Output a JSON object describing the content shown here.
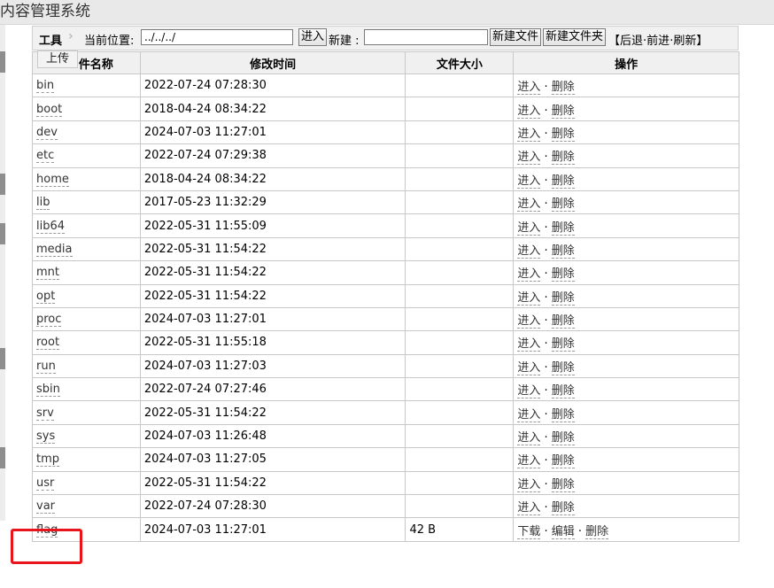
{
  "app": {
    "title": "内容管理系统"
  },
  "toolbar": {
    "tools_label": "工具",
    "arrow": "›",
    "current_location_label": "当前位置:",
    "path_value": "../../../",
    "enter_button": "进入",
    "new_label": "新建 :",
    "new_value": "",
    "new_file_button": "新建文件",
    "new_folder_button": "新建文件夹",
    "nav_open": "【",
    "back": "后退",
    "sep": "·",
    "forward": "前进",
    "refresh": "刷新",
    "nav_close": "】"
  },
  "upload_tab": {
    "label": "上传"
  },
  "table": {
    "headers": [
      "件名称",
      "修改时间",
      "文件大小",
      "操作"
    ],
    "rows": [
      {
        "name": "bin",
        "mtime": "2022-07-24 07:28:30",
        "size": "",
        "a1": "进入",
        "a2": "删除",
        "a3": ""
      },
      {
        "name": "boot",
        "mtime": "2018-04-24 08:34:22",
        "size": "",
        "a1": "进入",
        "a2": "删除",
        "a3": ""
      },
      {
        "name": "dev",
        "mtime": "2024-07-03 11:27:01",
        "size": "",
        "a1": "进入",
        "a2": "删除",
        "a3": ""
      },
      {
        "name": "etc",
        "mtime": "2022-07-24 07:29:38",
        "size": "",
        "a1": "进入",
        "a2": "删除",
        "a3": ""
      },
      {
        "name": "home",
        "mtime": "2018-04-24 08:34:22",
        "size": "",
        "a1": "进入",
        "a2": "删除",
        "a3": ""
      },
      {
        "name": "lib",
        "mtime": "2017-05-23 11:32:29",
        "size": "",
        "a1": "进入",
        "a2": "删除",
        "a3": ""
      },
      {
        "name": "lib64",
        "mtime": "2022-05-31 11:55:09",
        "size": "",
        "a1": "进入",
        "a2": "删除",
        "a3": ""
      },
      {
        "name": "media",
        "mtime": "2022-05-31 11:54:22",
        "size": "",
        "a1": "进入",
        "a2": "删除",
        "a3": ""
      },
      {
        "name": "mnt",
        "mtime": "2022-05-31 11:54:22",
        "size": "",
        "a1": "进入",
        "a2": "删除",
        "a3": ""
      },
      {
        "name": "opt",
        "mtime": "2022-05-31 11:54:22",
        "size": "",
        "a1": "进入",
        "a2": "删除",
        "a3": ""
      },
      {
        "name": "proc",
        "mtime": "2024-07-03 11:27:01",
        "size": "",
        "a1": "进入",
        "a2": "删除",
        "a3": ""
      },
      {
        "name": "root",
        "mtime": "2022-05-31 11:55:18",
        "size": "",
        "a1": "进入",
        "a2": "删除",
        "a3": ""
      },
      {
        "name": "run",
        "mtime": "2024-07-03 11:27:03",
        "size": "",
        "a1": "进入",
        "a2": "删除",
        "a3": ""
      },
      {
        "name": "sbin",
        "mtime": "2022-07-24 07:27:46",
        "size": "",
        "a1": "进入",
        "a2": "删除",
        "a3": ""
      },
      {
        "name": "srv",
        "mtime": "2022-05-31 11:54:22",
        "size": "",
        "a1": "进入",
        "a2": "删除",
        "a3": ""
      },
      {
        "name": "sys",
        "mtime": "2024-07-03 11:26:48",
        "size": "",
        "a1": "进入",
        "a2": "删除",
        "a3": ""
      },
      {
        "name": "tmp",
        "mtime": "2024-07-03 11:27:05",
        "size": "",
        "a1": "进入",
        "a2": "删除",
        "a3": ""
      },
      {
        "name": "usr",
        "mtime": "2022-05-31 11:54:22",
        "size": "",
        "a1": "进入",
        "a2": "删除",
        "a3": ""
      },
      {
        "name": "var",
        "mtime": "2022-07-24 07:28:30",
        "size": "",
        "a1": "进入",
        "a2": "删除",
        "a3": ""
      },
      {
        "name": "flag",
        "mtime": "2024-07-03 11:27:01",
        "size": "42 B",
        "a1": "下载",
        "a2": "编辑",
        "a3": "删除"
      }
    ]
  },
  "colors": {
    "highlight": "#e8161c",
    "header_bg": "#e9e9e9"
  }
}
